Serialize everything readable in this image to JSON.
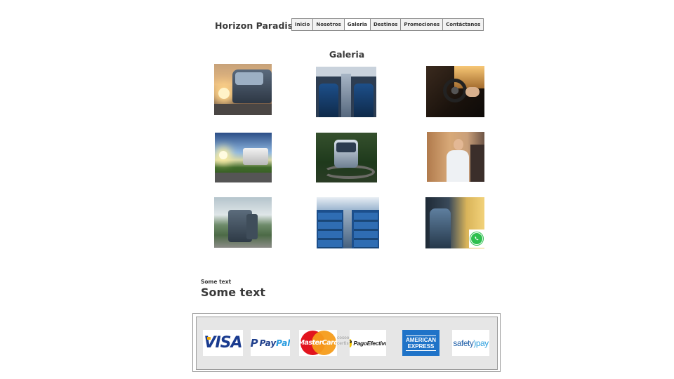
{
  "header": {
    "brand": "Horizon Paradise",
    "nav": [
      {
        "label": "Inicio",
        "active": false
      },
      {
        "label": "Nosotros",
        "active": false
      },
      {
        "label": "Galeria",
        "active": true
      },
      {
        "label": "Destinos",
        "active": false
      },
      {
        "label": "Promociones",
        "active": false
      },
      {
        "label": "Contáctanos",
        "active": false
      }
    ]
  },
  "gallery": {
    "title": "Galeria"
  },
  "content": {
    "small_text": "Some text",
    "big_text": "Some text"
  },
  "payments": {
    "visa": "VISA",
    "paypal_1": "Pay",
    "paypal_2": "Pal",
    "mastercard": "MasterCard",
    "mastercard_ghost_1": "cosoon",
    "mastercard_ghost_2": "certis",
    "pagoefectivo_icon": "P",
    "pagoefectivo": "PagoEfectivo",
    "amex_1": "AMERICAN",
    "amex_2": "EXPRESS",
    "safety_1": "safety",
    "safety_2": ")pay"
  },
  "colors": {
    "whatsapp": "#2ec04f",
    "amex": "#1f73c8",
    "visa": "#1a3b8f"
  },
  "icons": {
    "whatsapp": "whatsapp-icon"
  }
}
